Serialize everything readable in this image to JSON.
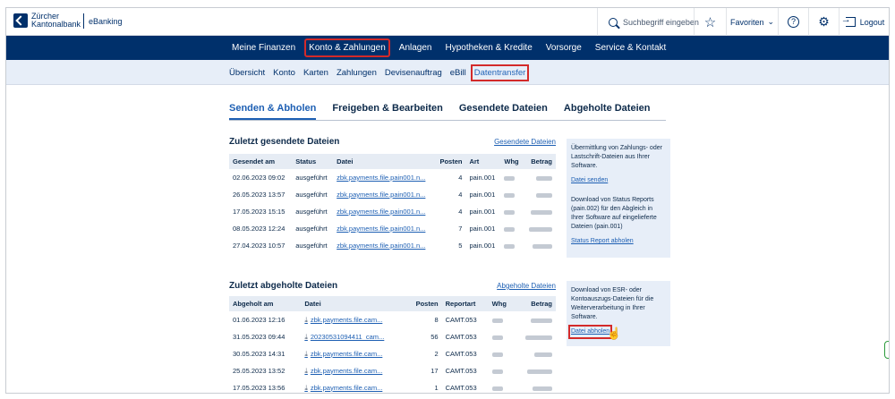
{
  "topbar": {
    "brand_line1": "Zürcher",
    "brand_line2": "Kantonalbank",
    "brand_product": "eBanking",
    "search_placeholder": "Suchbegriff eingeben",
    "favorites_label": "Favoriten",
    "help_glyph": "?",
    "logout_label": "Logout"
  },
  "main_nav": {
    "items": [
      {
        "label": "Meine Finanzen",
        "active": false
      },
      {
        "label": "Konto & Zahlungen",
        "active": true
      },
      {
        "label": "Anlagen",
        "active": false
      },
      {
        "label": "Hypotheken & Kredite",
        "active": false
      },
      {
        "label": "Vorsorge",
        "active": false
      },
      {
        "label": "Service & Kontakt",
        "active": false
      }
    ]
  },
  "sub_nav": {
    "items": [
      {
        "label": "Übersicht",
        "active": false
      },
      {
        "label": "Konto",
        "active": false
      },
      {
        "label": "Karten",
        "active": false
      },
      {
        "label": "Zahlungen",
        "active": false
      },
      {
        "label": "Devisenauftrag",
        "active": false
      },
      {
        "label": "eBill",
        "active": false
      },
      {
        "label": "Datentransfer",
        "active": true
      }
    ]
  },
  "tabs": [
    {
      "label": "Senden & Abholen",
      "active": true
    },
    {
      "label": "Freigeben & Bearbeiten",
      "active": false
    },
    {
      "label": "Gesendete Dateien",
      "active": false
    },
    {
      "label": "Abgeholte Dateien",
      "active": false
    }
  ],
  "sent": {
    "title": "Zuletzt gesendete Dateien",
    "link": "Gesendete Dateien",
    "headers": {
      "date": "Gesendet am",
      "status": "Status",
      "file": "Datei",
      "posts": "Posten",
      "type": "Art",
      "currency": "Whg",
      "amount": "Betrag"
    },
    "rows": [
      {
        "date": "02.06.2023 09:02",
        "status": "ausgeführt",
        "file": "zbk.payments.file.pain001.n...",
        "posts": "4",
        "type": "pain.001"
      },
      {
        "date": "26.05.2023 13:57",
        "status": "ausgeführt",
        "file": "zbk.payments.file.pain001.n...",
        "posts": "4",
        "type": "pain.001"
      },
      {
        "date": "17.05.2023 15:15",
        "status": "ausgeführt",
        "file": "zbk.payments.file.pain001.n...",
        "posts": "4",
        "type": "pain.001"
      },
      {
        "date": "08.05.2023 12:24",
        "status": "ausgeführt",
        "file": "zbk.payments.file.pain001.n...",
        "posts": "7",
        "type": "pain.001"
      },
      {
        "date": "27.04.2023 10:57",
        "status": "ausgeführt",
        "file": "zbk.payments.file.pain001.n...",
        "posts": "5",
        "type": "pain.001"
      }
    ]
  },
  "fetched": {
    "title": "Zuletzt abgeholte Dateien",
    "link": "Abgeholte Dateien",
    "headers": {
      "date": "Abgeholt am",
      "file": "Datei",
      "posts": "Posten",
      "type": "Reportart",
      "currency": "Whg",
      "amount": "Betrag"
    },
    "rows": [
      {
        "date": "01.06.2023 12:16",
        "file": "zbk.payments.file.cam...",
        "posts": "8",
        "type": "CAMT.053"
      },
      {
        "date": "31.05.2023 09:44",
        "file": "20230531094411_cam...",
        "posts": "56",
        "type": "CAMT.053"
      },
      {
        "date": "30.05.2023 14:31",
        "file": "zbk.payments.file.cam...",
        "posts": "2",
        "type": "CAMT.053"
      },
      {
        "date": "25.05.2023 13:52",
        "file": "zbk.payments.file.cam...",
        "posts": "17",
        "type": "CAMT.053"
      },
      {
        "date": "17.05.2023 13:56",
        "file": "zbk.payments.file.cam...",
        "posts": "1",
        "type": "CAMT.053"
      }
    ]
  },
  "sidebox_send": {
    "text1": "Übermittlung von Zahlungs- oder Lastschrift-Dateien aus Ihrer Software.",
    "link1": "Datei senden",
    "text2": "Download von Status Reports (pain.002) für den Abgleich in Ihrer Software auf eingelieferte Dateien (pain.001)",
    "link2": "Status Report abholen"
  },
  "sidebox_fetch": {
    "text": "Download von ESR- oder Kontoauszugs-Dateien für die Weiterverarbeitung in Ihrer Software.",
    "link": "Datei abholen"
  },
  "colors": {
    "nav_bg": "#00306b",
    "highlight": "#d32a2a",
    "link": "#1d5fb3",
    "subnav_bg": "#e7eef8"
  }
}
